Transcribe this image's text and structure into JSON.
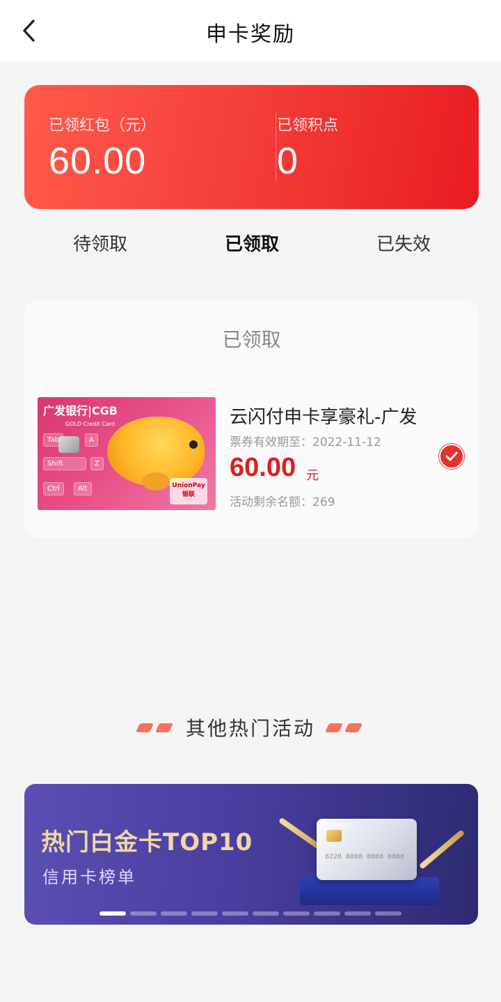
{
  "header": {
    "title": "申卡奖励"
  },
  "summary": {
    "redpacket_label": "已领红包（元）",
    "redpacket_value": "60.00",
    "points_label": "已领积点",
    "points_value": "0"
  },
  "tabs": [
    {
      "label": "待领取",
      "active": false
    },
    {
      "label": "已领取",
      "active": true
    },
    {
      "label": "已失效",
      "active": false
    }
  ],
  "list": {
    "title": "已领取",
    "items": [
      {
        "title": "云闪付申卡享豪礼-广发",
        "validity": "票券有效期至：2022-11-12",
        "amount": "60.00",
        "unit": "元",
        "remaining": "活动剩余名额：269",
        "card_image": {
          "bank_logo": "广发银行|CGB",
          "card_name": "GOLD Credit Card",
          "keys": [
            "Tab",
            "A",
            "Shift",
            "Z",
            "Ctrl",
            "Alt"
          ],
          "badge": "UnionPay 银联"
        }
      }
    ]
  },
  "section": {
    "title": "其他热门活动"
  },
  "banner": {
    "title": "热门白金卡TOP10",
    "subtitle": "信用卡榜单",
    "card_number": "6228 8888 8888 8888",
    "slides": 10,
    "active_slide": 0
  },
  "colors": {
    "accent": "#e5322d",
    "amount": "#d9201f",
    "banner_bg": "#4a3fa0",
    "page_bg": "#f4f4f4"
  },
  "icons": {
    "back": "chevron-left-icon",
    "check": "check-circle-icon"
  }
}
